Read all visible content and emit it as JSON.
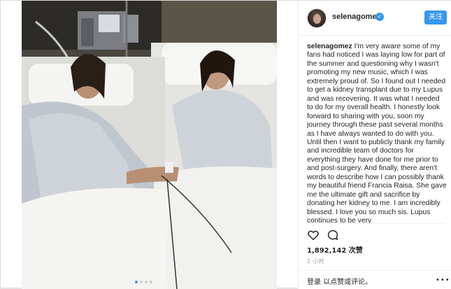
{
  "post": {
    "username": "selenagomez",
    "follow_label": "关注",
    "caption_user": "selenagomez",
    "caption_text": " I'm very aware some of my fans had noticed I was laying low for part of the summer and questioning why I wasn't promoting my new music, which I was extremely proud of. So I found out I needed to get a kidney transplant due to my Lupus and was recovering. It was what I needed to do for my overall health. I honestly look forward to sharing with you, soon my journey through these past several months as I have always wanted to do with you. Until then I want to publicly thank my family and incredible team of doctors for everything they have done for me prior to and post-surgery. And finally, there aren't words to describe how I can possibly thank my beautiful friend Francia Raisa. She gave me the ultimate gift and sacrifice by donating her kidney to me. I am incredibly blessed. I love you so much sis. Lupus continues to be very",
    "likes": "1,892,142 次赞",
    "time": "2 小时",
    "login_prompt": "登录 以点赞或评论。",
    "more": "•••"
  },
  "icons": {
    "verified": "verified-badge-icon",
    "like": "heart-icon",
    "comment": "comment-icon",
    "more": "more-options-icon"
  },
  "carousel": {
    "count": 4,
    "active_index": 0
  },
  "colors": {
    "accent": "#3897f0",
    "text": "#262626",
    "muted": "#999999"
  }
}
